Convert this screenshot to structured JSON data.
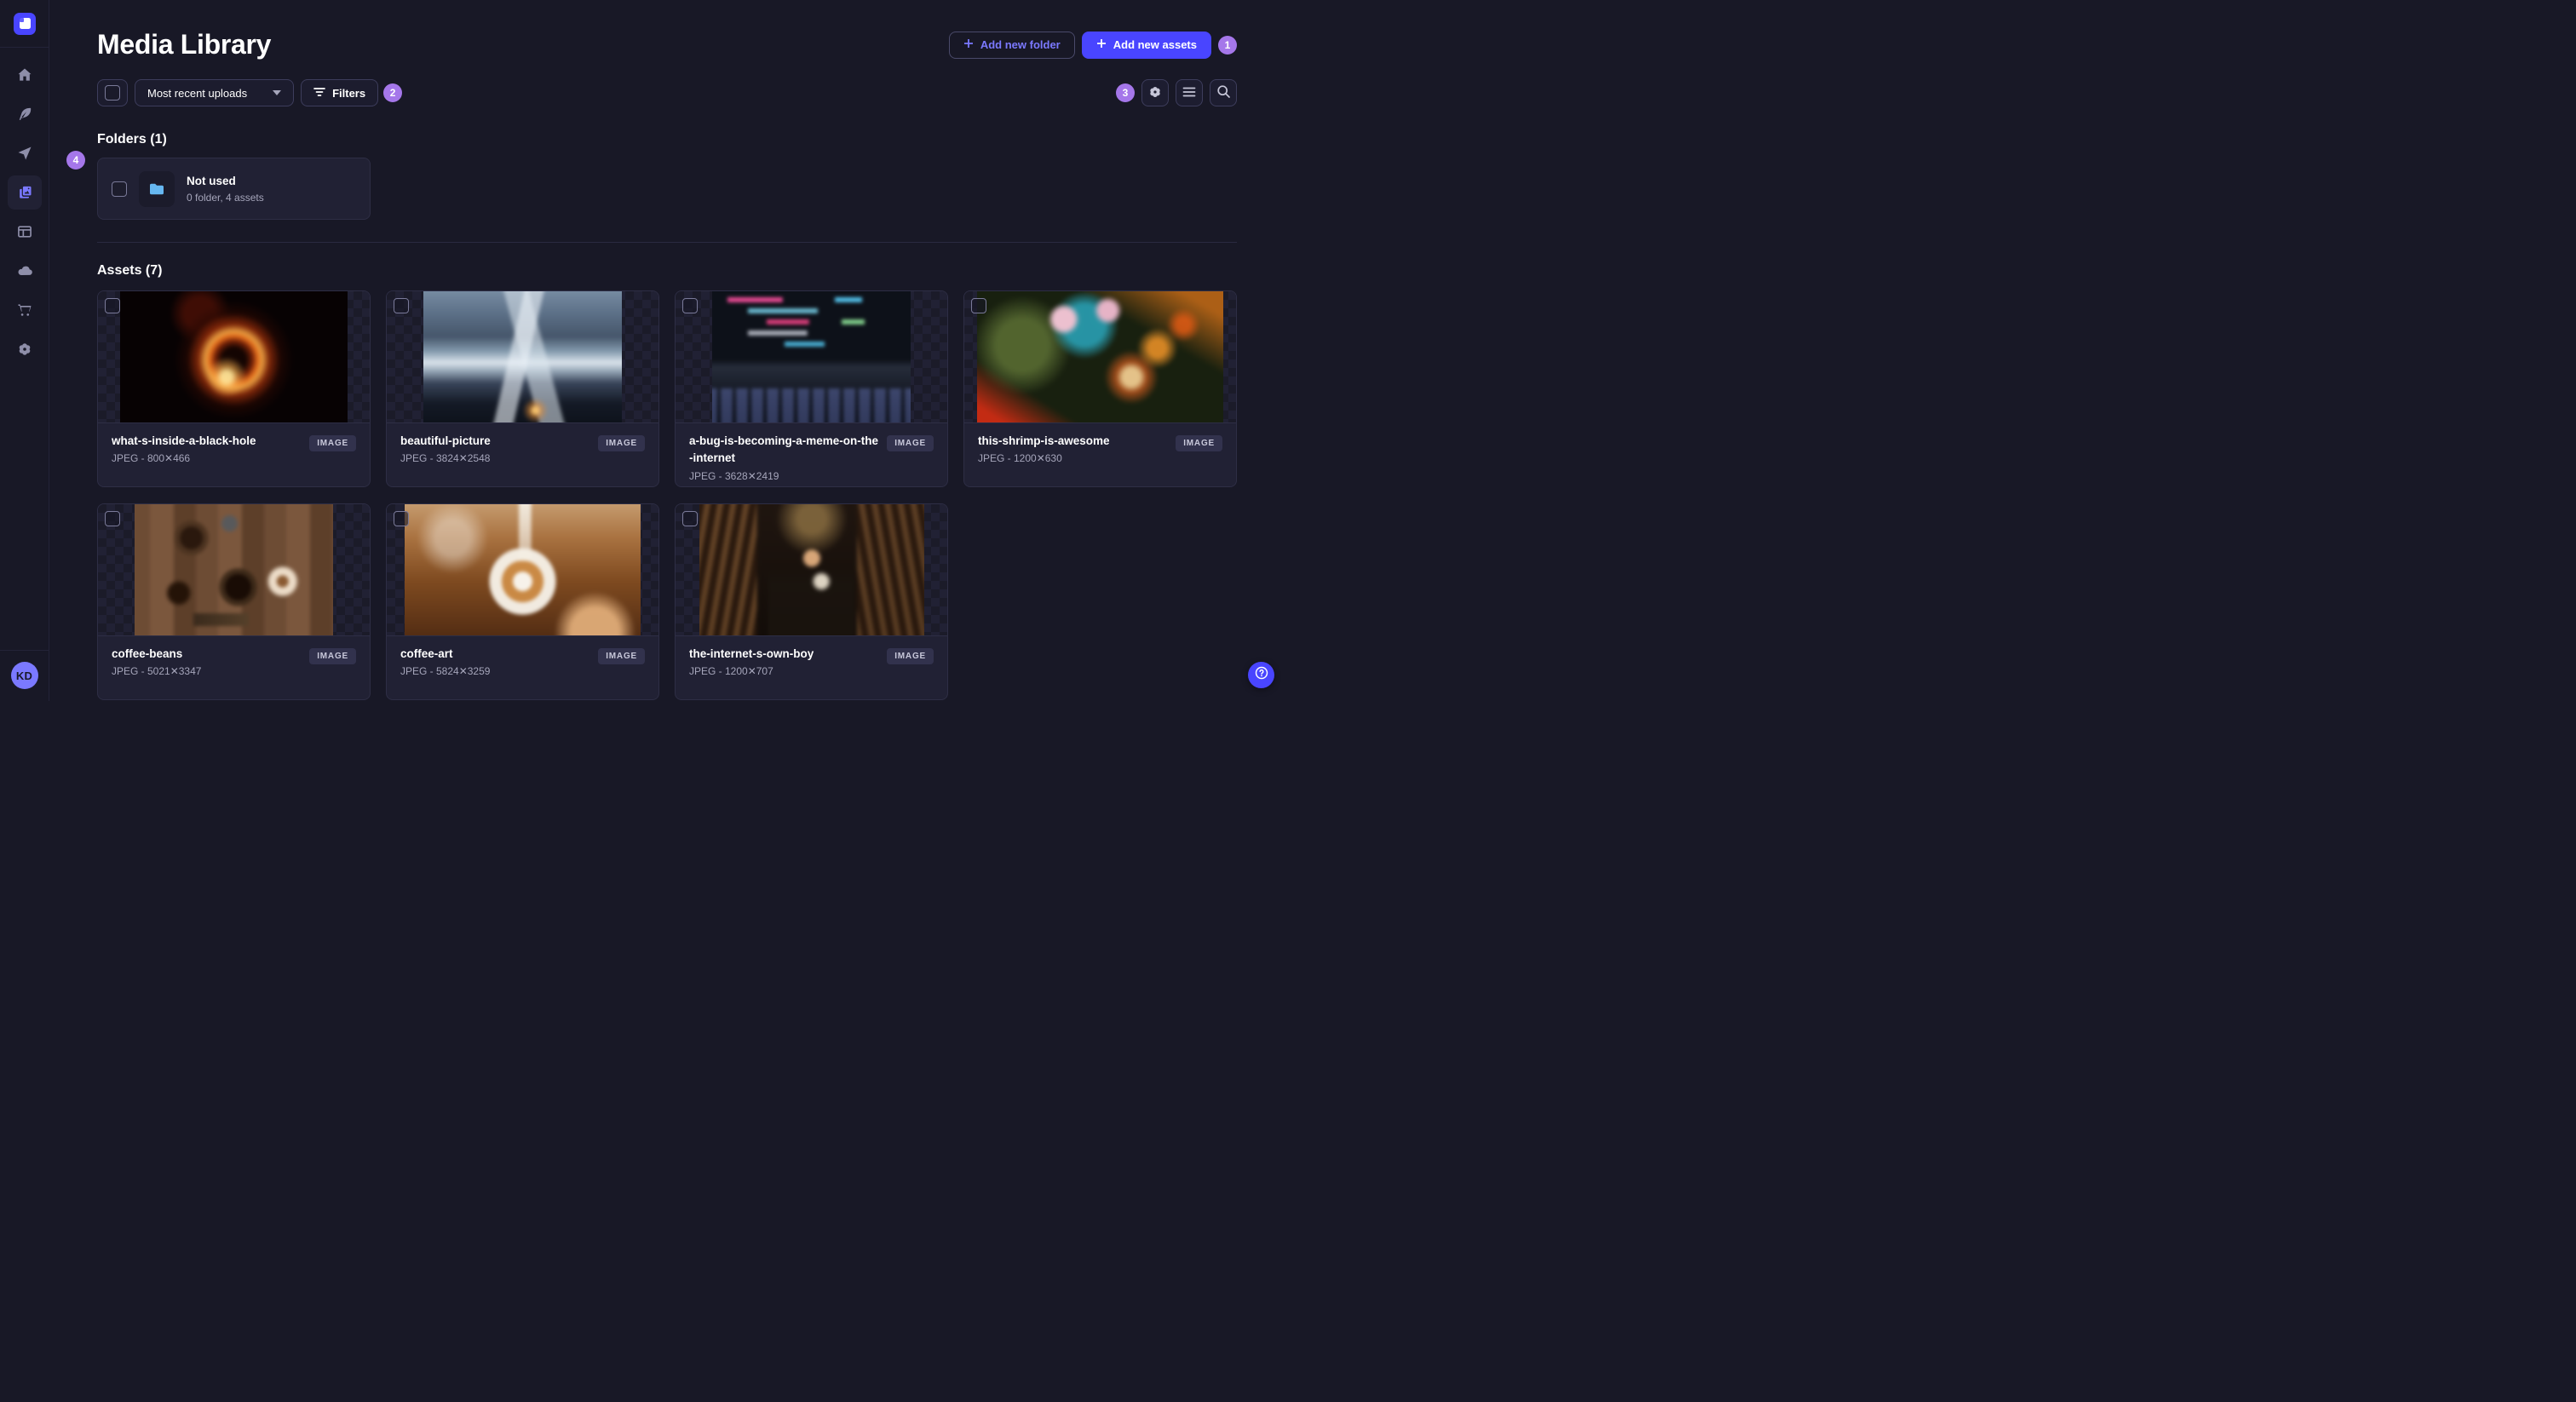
{
  "header": {
    "title": "Media Library",
    "add_folder_label": "Add new folder",
    "add_assets_label": "Add new assets"
  },
  "toolbar": {
    "sort_value": "Most recent uploads",
    "filters_label": "Filters"
  },
  "tour": {
    "badge1": "1",
    "badge2": "2",
    "badge3": "3",
    "badge4": "4"
  },
  "folders": {
    "heading": "Folders (1)",
    "items": [
      {
        "name": "Not used",
        "count": "0 folder, 4 assets"
      }
    ]
  },
  "assets": {
    "heading": "Assets (7)",
    "items": [
      {
        "name": "what-s-inside-a-black-hole",
        "meta": "JPEG - 800✕466",
        "type": "IMAGE",
        "thumb": "t-blackhole",
        "aspect": 1.72
      },
      {
        "name": "beautiful-picture",
        "meta": "JPEG - 3824✕2548",
        "type": "IMAGE",
        "thumb": "t-mountains",
        "aspect": 1.5
      },
      {
        "name": "a-bug-is-becoming-a-meme-on-the-internet",
        "meta": "JPEG - 3628✕2419",
        "type": "IMAGE",
        "thumb": "t-code",
        "aspect": 1.5
      },
      {
        "name": "this-shrimp-is-awesome",
        "meta": "JPEG - 1200✕630",
        "type": "IMAGE",
        "thumb": "t-shrimp",
        "aspect": 1.9
      },
      {
        "name": "coffee-beans",
        "meta": "JPEG - 5021✕3347",
        "type": "IMAGE",
        "thumb": "t-beans",
        "aspect": 1.5
      },
      {
        "name": "coffee-art",
        "meta": "JPEG - 5824✕3259",
        "type": "IMAGE",
        "thumb": "t-latte",
        "aspect": 1.79
      },
      {
        "name": "the-internet-s-own-boy",
        "meta": "JPEG - 1200✕707",
        "type": "IMAGE",
        "thumb": "t-boy",
        "aspect": 1.7
      }
    ]
  },
  "user": {
    "initials": "KD"
  },
  "colors": {
    "brand": "#4945ff",
    "brand_light": "#7b79ff",
    "tour_badge": "#a577ea",
    "folder_icon": "#66b7f1",
    "background": "#181826",
    "surface": "#212134"
  }
}
